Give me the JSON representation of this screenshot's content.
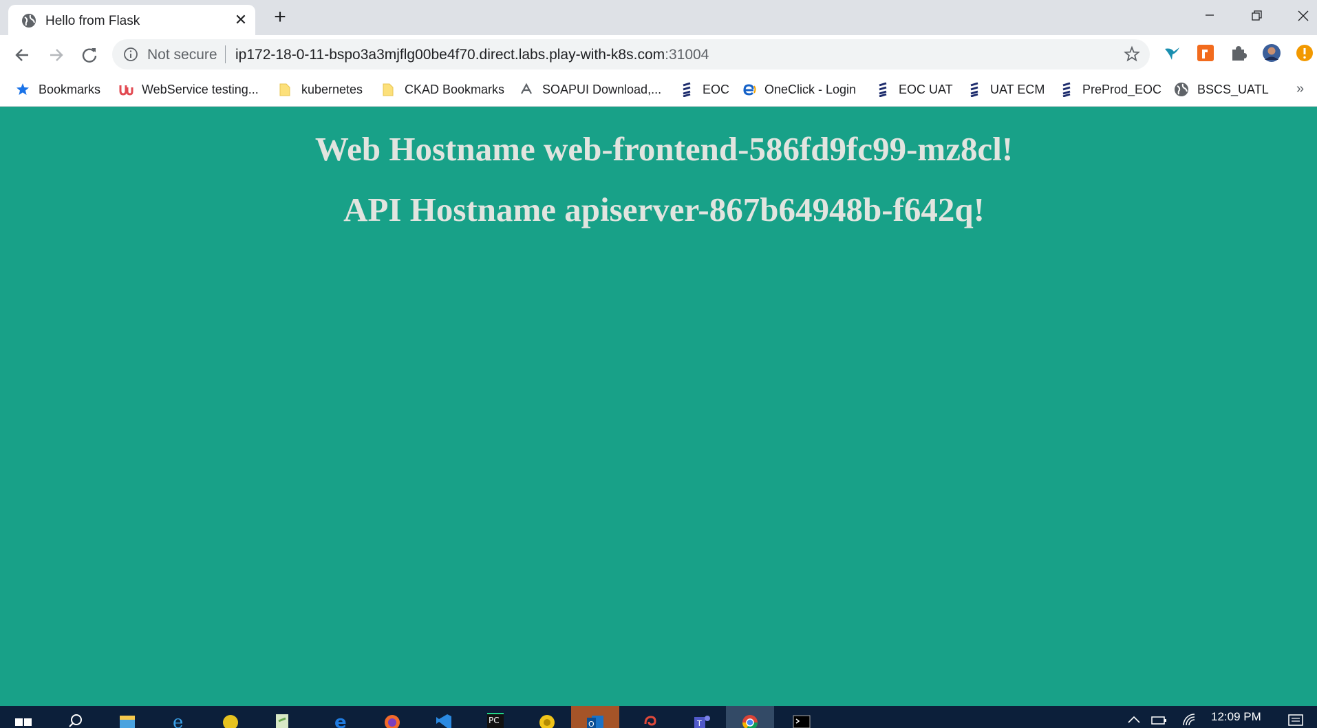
{
  "tab": {
    "title": "Hello from Flask",
    "close_label": "✕",
    "new_tab_label": "+"
  },
  "omnibox": {
    "security_label": "Not secure",
    "url_host": "ip172-18-0-11-bspo3a3mjflg00be4f70.direct.labs.play-with-k8s.com",
    "url_port": ":31004"
  },
  "bookmarks": [
    {
      "label": "Bookmarks",
      "icon": "star-icon"
    },
    {
      "label": "WebService testing...",
      "icon": "udemy-icon"
    },
    {
      "label": "kubernetes",
      "icon": "folder-icon"
    },
    {
      "label": "CKAD Bookmarks",
      "icon": "folder-icon"
    },
    {
      "label": "SOAPUI Download,...",
      "icon": "soapui-icon"
    },
    {
      "label": "EOC",
      "icon": "ericsson-icon"
    },
    {
      "label": "OneClick - Login",
      "icon": "e-icon"
    },
    {
      "label": "EOC UAT",
      "icon": "ericsson-icon"
    },
    {
      "label": "UAT ECM",
      "icon": "ericsson-icon"
    },
    {
      "label": "PreProd_EOC",
      "icon": "ericsson-icon"
    },
    {
      "label": "BSCS_UATL",
      "icon": "globe-icon"
    }
  ],
  "bookmarks_more": "»",
  "content": {
    "web_line": "Web Hostname web-frontend-586fd9fc99-mz8cl!",
    "api_line": "API Hostname apiserver-867b64948b-f642q!"
  },
  "taskbar": {
    "time": "12:09 PM"
  },
  "colors": {
    "page_background": "#18a188",
    "heading_text": "#e2e4df",
    "taskbar": "#0c1f3a"
  }
}
